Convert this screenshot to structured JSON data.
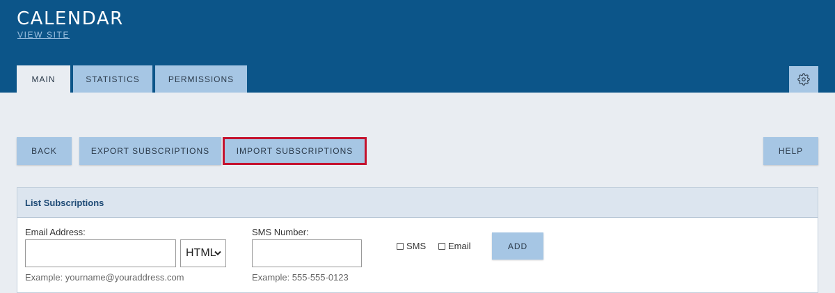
{
  "header": {
    "title": "CALENDAR",
    "view_site": "VIEW SITE",
    "bg_color": "#0c5589",
    "settings_icon": "gear-icon"
  },
  "tabs": [
    {
      "label": "MAIN",
      "active": true
    },
    {
      "label": "STATISTICS",
      "active": false
    },
    {
      "label": "PERMISSIONS",
      "active": false
    }
  ],
  "actions": {
    "back": "BACK",
    "export": "EXPORT SUBSCRIPTIONS",
    "import": "IMPORT SUBSCRIPTIONS",
    "help": "HELP",
    "highlight_color": "#c4122e"
  },
  "panel": {
    "title": "List Subscriptions",
    "email": {
      "label": "Email Address:",
      "value": "",
      "hint": "Example: yourname@youraddress.com"
    },
    "format": {
      "selected": "HTML"
    },
    "sms": {
      "label": "SMS Number:",
      "value": "",
      "hint": "Example: 555-555-0123"
    },
    "checkboxes": {
      "sms": {
        "label": "SMS",
        "checked": false
      },
      "email": {
        "label": "Email",
        "checked": false
      }
    },
    "add_button": "ADD"
  }
}
